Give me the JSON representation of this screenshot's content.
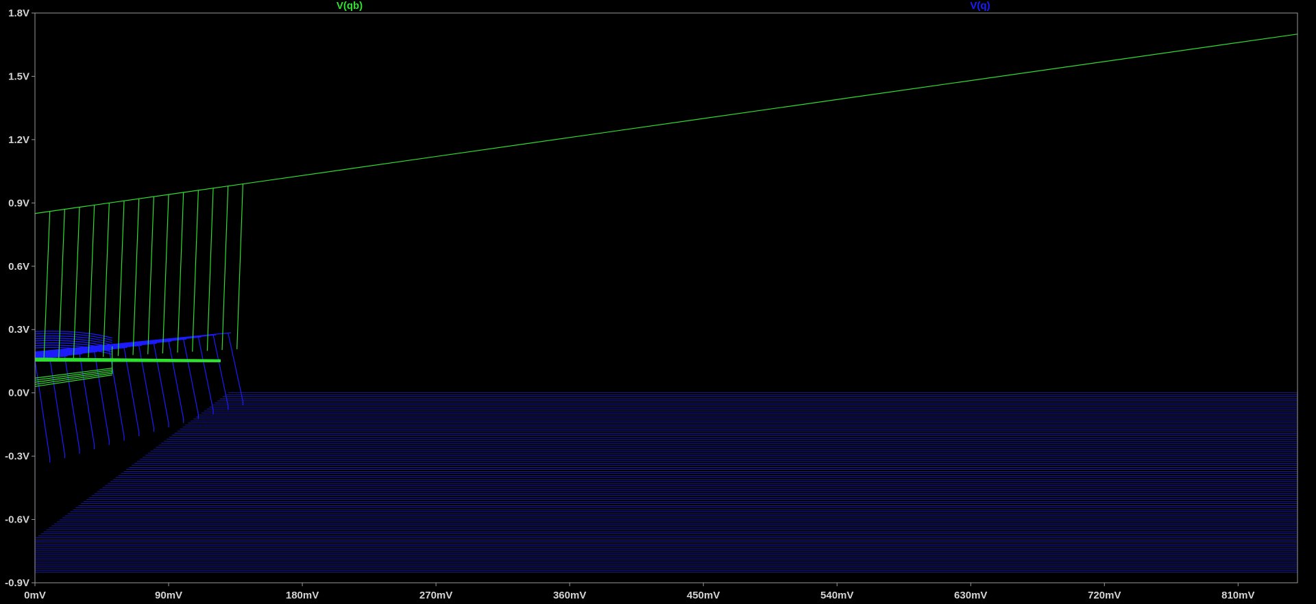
{
  "window": {
    "background": "#000000",
    "axis_color": "#9a9a9a"
  },
  "chart_data": {
    "type": "line",
    "xunit": "mV",
    "yunit": "V",
    "xlim": [
      0,
      850
    ],
    "ylim": [
      -0.9,
      1.8
    ],
    "xticks": [
      0,
      90,
      180,
      270,
      360,
      450,
      540,
      630,
      720,
      810
    ],
    "xtick_labels": [
      "0mV",
      "90mV",
      "180mV",
      "270mV",
      "360mV",
      "450mV",
      "540mV",
      "630mV",
      "720mV",
      "810mV"
    ],
    "yticks": [
      1.8,
      1.5,
      1.2,
      0.9,
      0.6,
      0.3,
      0.0,
      -0.3,
      -0.6,
      -0.9
    ],
    "ytick_labels": [
      "1.8V",
      "1.5V",
      "1.2V",
      "0.9V",
      "0.6V",
      "0.3V",
      "0.0V",
      "-0.3V",
      "-0.6V",
      "-0.9V"
    ],
    "grid": false,
    "series": [
      {
        "name": "V(qb)",
        "color": "#2fe02f",
        "high_branch": {
          "x": [
            0,
            850
          ],
          "y": [
            0.85,
            1.7
          ]
        },
        "family_tops_x": [
          0,
          10,
          20,
          30,
          40,
          50,
          60,
          70,
          80,
          90,
          100,
          110,
          120,
          130
        ],
        "mid_plateau_y": 0.155
      },
      {
        "name": "V(q)",
        "color": "#1c1cff",
        "dense_color": "#1a1a9a",
        "steps": 90,
        "step_y_top": 0.0,
        "step_y_bottom": -0.85,
        "family_tops_x": [
          0,
          10,
          20,
          30,
          40,
          50,
          60,
          70,
          80,
          90,
          100,
          110,
          120,
          130
        ],
        "mid_plateau_y": 0.155
      }
    ]
  }
}
